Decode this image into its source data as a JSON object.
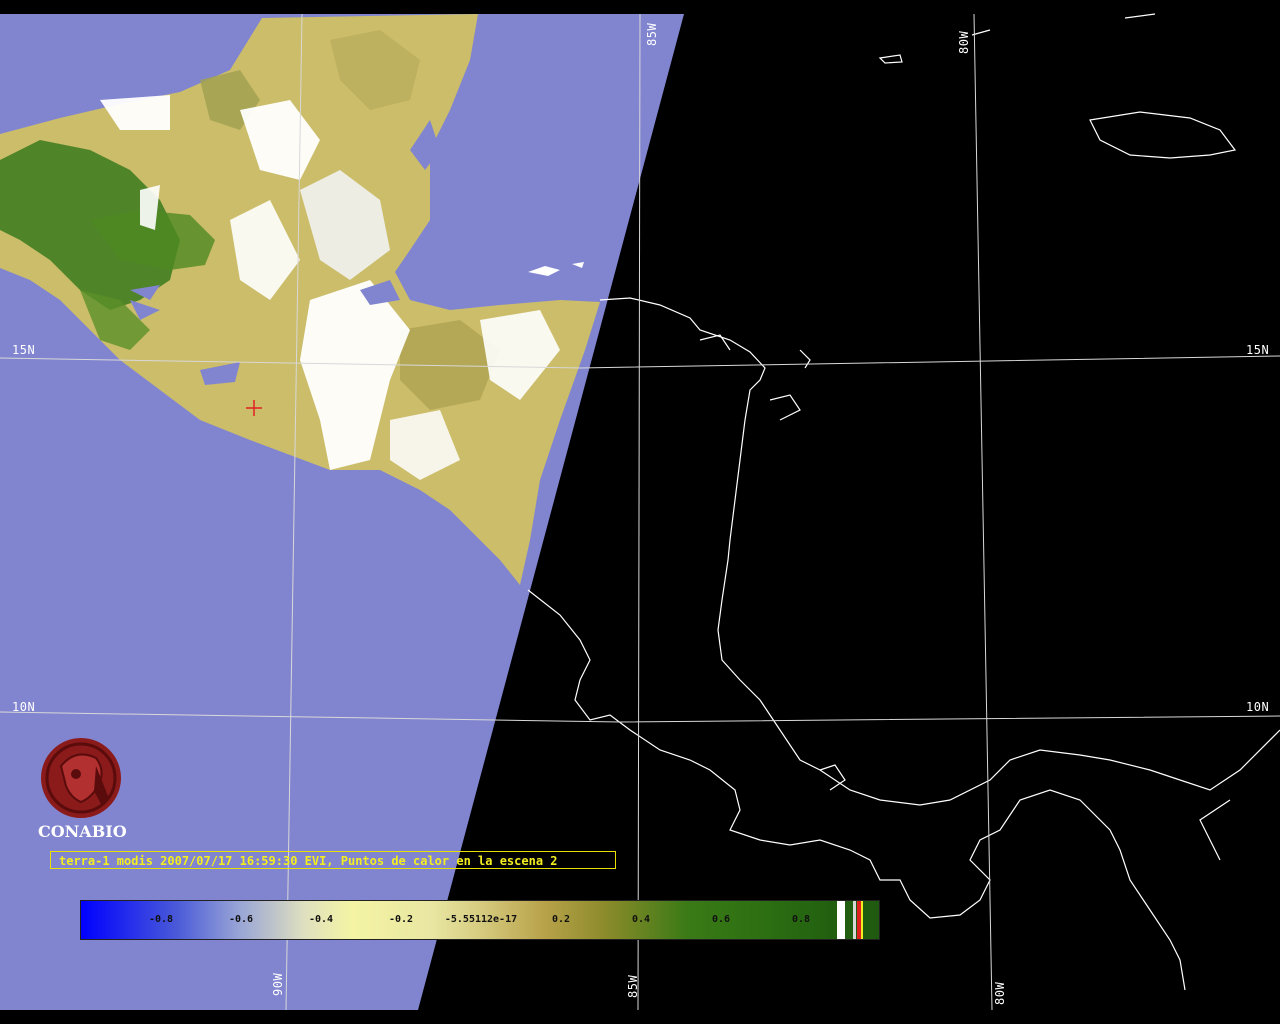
{
  "grid_labels": {
    "lat_15n_left": "15N",
    "lat_15n_right": "15N",
    "lat_10n_left": "10N",
    "lat_10n_right": "10N",
    "lon_85w_top": "85W",
    "lon_80w_top": "80W",
    "lon_90w_bottom": "90W",
    "lon_85w_bottom": "85W",
    "lon_80w_bottom": "80W"
  },
  "logo": {
    "text": "CONABIO",
    "icon": "conabio-macaw-seal"
  },
  "caption": "terra-1 modis 2007/07/17 16:59:30 EVI, Puntos de calor en la escena 2",
  "colorbar": {
    "ticks": [
      "-0.8",
      "-0.6",
      "-0.4",
      "-0.2",
      "-5.55112e-17",
      "0.2",
      "0.4",
      "0.6",
      "0.8"
    ],
    "range": [
      -1,
      1
    ]
  },
  "colors": {
    "ocean_swath": "#8185d0",
    "no_data": "#000000",
    "coastline": "#ffffff",
    "vegetation_high": "#2f6e1c",
    "vegetation_low": "#d9cc7a",
    "cloud": "#ffffff",
    "hotspot": "#e02020",
    "caption_text": "#f2ec20"
  },
  "hotspot_count": 1
}
